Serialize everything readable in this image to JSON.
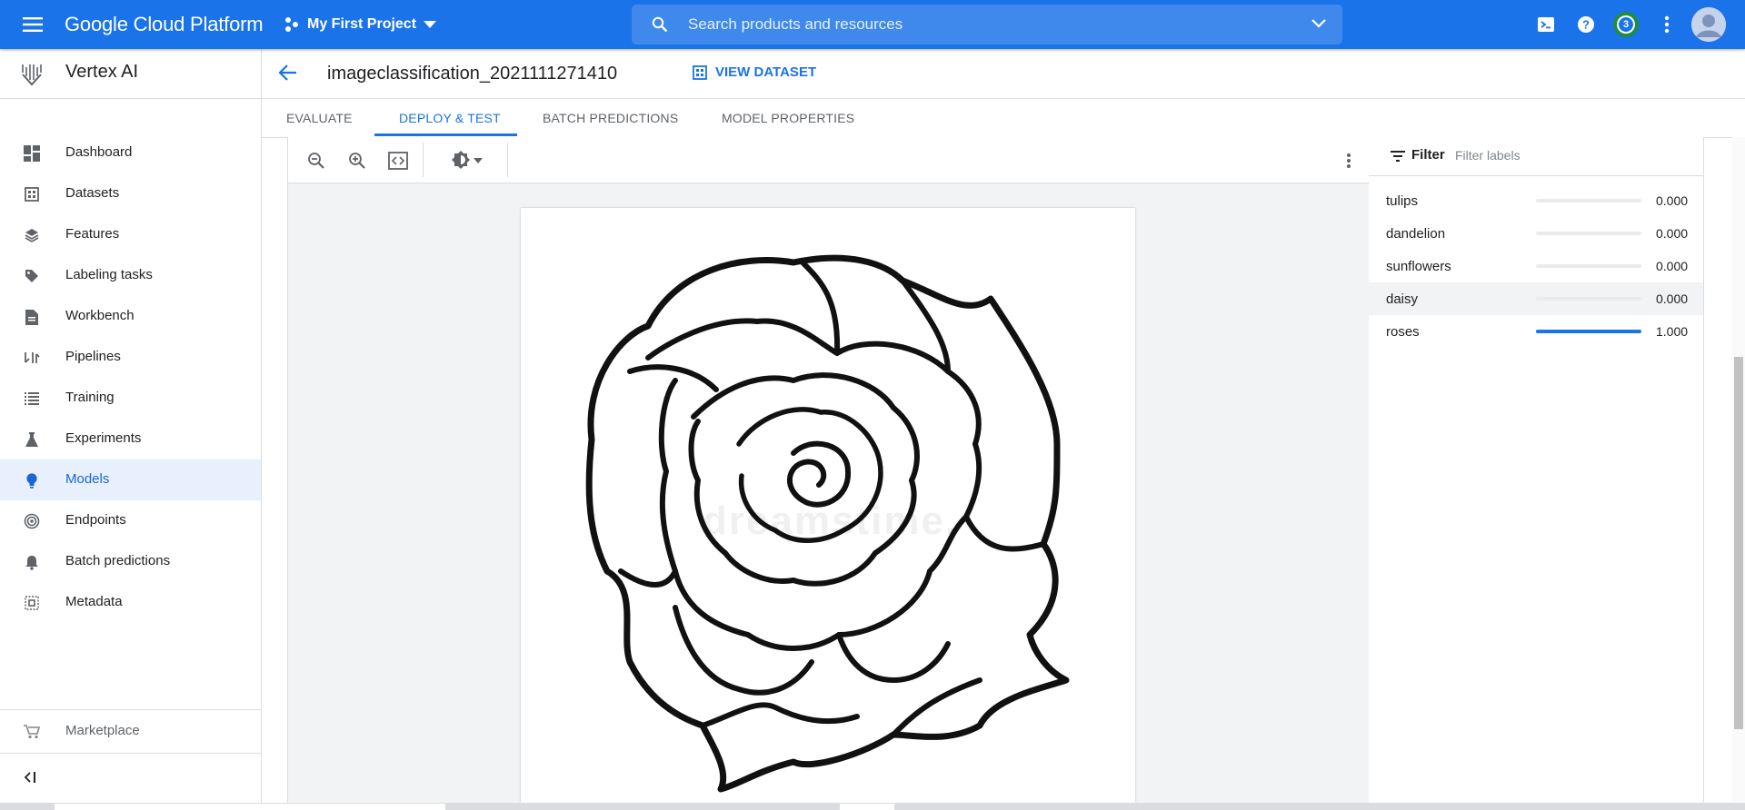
{
  "topbar": {
    "brand": "Google Cloud Platform",
    "project": "My First Project",
    "search_placeholder": "Search products and resources",
    "notification_count": "3"
  },
  "sidebar": {
    "title": "Vertex AI",
    "items": [
      {
        "label": "Dashboard",
        "icon": "dashboard-icon"
      },
      {
        "label": "Datasets",
        "icon": "datasets-icon"
      },
      {
        "label": "Features",
        "icon": "features-icon"
      },
      {
        "label": "Labeling tasks",
        "icon": "label-tag-icon"
      },
      {
        "label": "Workbench",
        "icon": "workbench-icon"
      },
      {
        "label": "Pipelines",
        "icon": "pipelines-icon"
      },
      {
        "label": "Training",
        "icon": "training-icon"
      },
      {
        "label": "Experiments",
        "icon": "experiments-flask-icon"
      },
      {
        "label": "Models",
        "icon": "models-bulb-icon",
        "active": true
      },
      {
        "label": "Endpoints",
        "icon": "endpoints-icon"
      },
      {
        "label": "Batch predictions",
        "icon": "batch-predictions-bell-icon"
      },
      {
        "label": "Metadata",
        "icon": "metadata-icon"
      }
    ],
    "marketplace": "Marketplace"
  },
  "header": {
    "model_name": "imageclassification_2021111271410",
    "view_dataset": "VIEW DATASET"
  },
  "tabs": [
    {
      "label": "EVALUATE"
    },
    {
      "label": "DEPLOY & TEST",
      "active": true
    },
    {
      "label": "BATCH PREDICTIONS"
    },
    {
      "label": "MODEL PROPERTIES"
    }
  ],
  "labels_panel": {
    "filter_label": "Filter",
    "filter_placeholder": "Filter labels",
    "rows": [
      {
        "name": "tulips",
        "value": "0.000",
        "score": 0.0
      },
      {
        "name": "dandelion",
        "value": "0.000",
        "score": 0.0
      },
      {
        "name": "sunflowers",
        "value": "0.000",
        "score": 0.0
      },
      {
        "name": "daisy",
        "value": "0.000",
        "score": 0.0,
        "highlighted": true
      },
      {
        "name": "roses",
        "value": "1.000",
        "score": 1.0
      }
    ]
  },
  "colors": {
    "brand_blue": "#1a73e8",
    "active_nav_bg": "#e8f0fe",
    "score_bar": "#1a73e8"
  }
}
